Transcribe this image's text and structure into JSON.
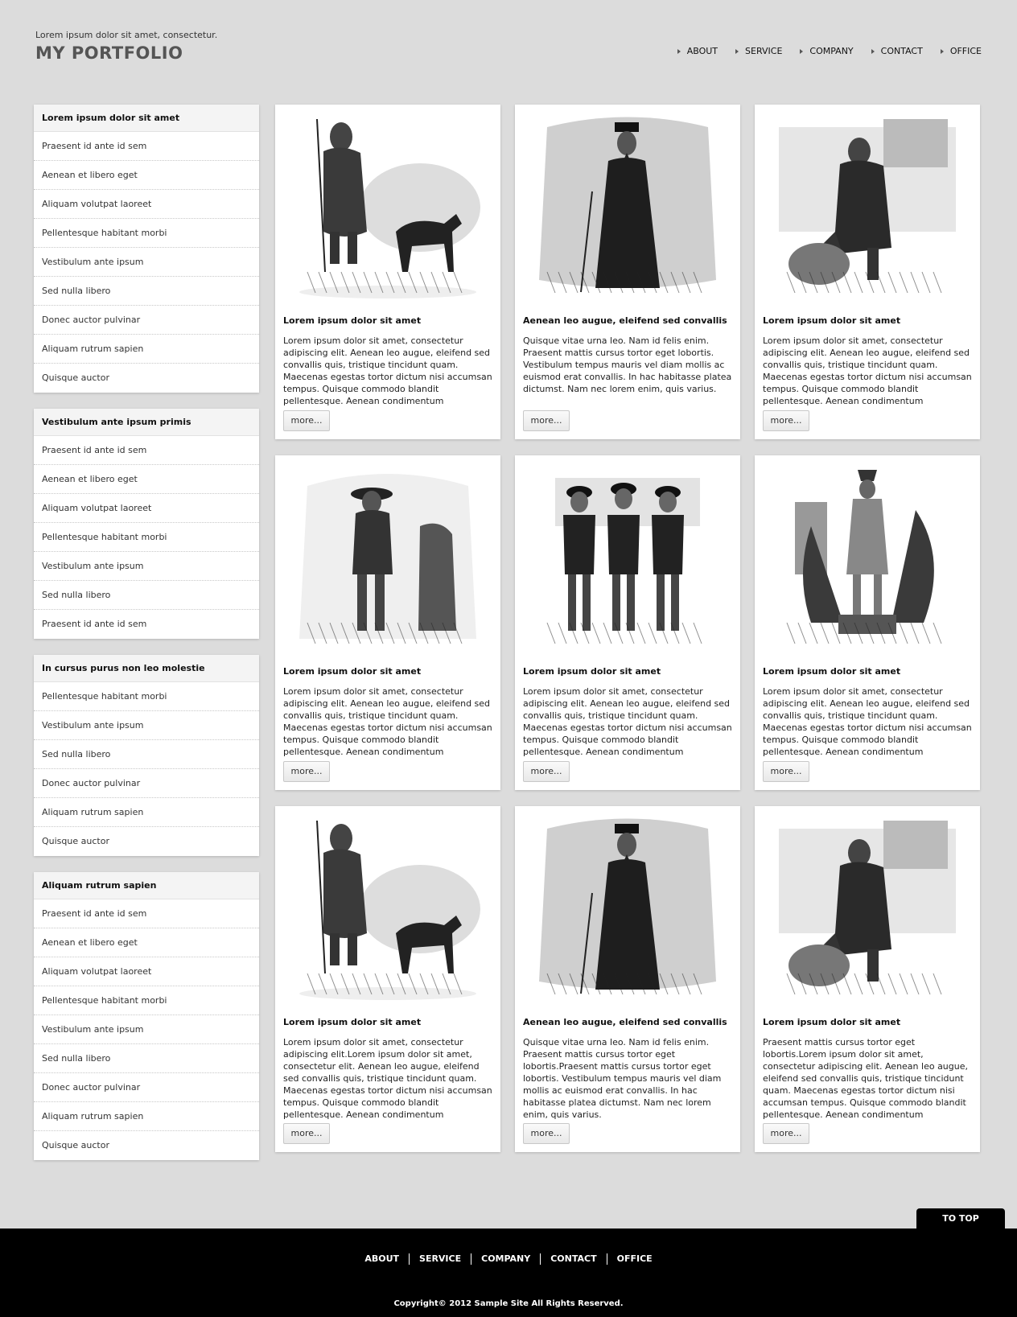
{
  "header": {
    "tagline": "Lorem ipsum dolor sit amet, consectetur.",
    "title": "MY PORTFOLIO",
    "nav": [
      "ABOUT",
      "SERVICE",
      "COMPANY",
      "CONTACT",
      "OFFICE"
    ]
  },
  "sidebar": [
    {
      "title": "Lorem ipsum dolor sit amet",
      "items": [
        "Praesent id ante id sem",
        "Aenean et libero eget",
        "Aliquam volutpat laoreet",
        "Pellentesque habitant morbi",
        "Vestibulum ante ipsum",
        "Sed nulla libero",
        "Donec auctor pulvinar",
        "Aliquam rutrum sapien",
        "Quisque auctor"
      ]
    },
    {
      "title": "Vestibulum ante ipsum primis",
      "items": [
        "Praesent id ante id sem",
        "Aenean et libero eget",
        "Aliquam volutpat laoreet",
        "Pellentesque habitant morbi",
        "Vestibulum ante ipsum",
        "Sed nulla libero",
        "Praesent id ante id sem"
      ]
    },
    {
      "title": "In cursus purus non leo molestie",
      "items": [
        "Pellentesque habitant morbi",
        "Vestibulum ante ipsum",
        "Sed nulla libero",
        "Donec auctor pulvinar",
        "Aliquam rutrum sapien",
        "Quisque auctor"
      ]
    },
    {
      "title": "Aliquam rutrum sapien",
      "items": [
        "Praesent id ante id sem",
        "Aenean et libero eget",
        "Aliquam volutpat laoreet",
        "Pellentesque habitant morbi",
        "Vestibulum ante ipsum",
        "Sed nulla libero",
        "Donec auctor pulvinar",
        "Aliquam rutrum sapien",
        "Quisque auctor"
      ]
    }
  ],
  "cards": [
    {
      "title": "Lorem ipsum dolor sit amet",
      "text": "Lorem ipsum dolor sit amet, consectetur adipiscing elit. Aenean leo augue, eleifend sed convallis quis, tristique tincidunt quam. Maecenas egestas tortor dictum nisi accumsan tempus. Quisque commodo blandit pellentesque. Aenean condimentum",
      "button": "more...",
      "image": "explorer-with-dog-engraving"
    },
    {
      "title": "Aenean leo augue, eleifend sed convallis",
      "text": "Quisque vitae urna leo. Nam id felis enim. Praesent mattis cursus tortor eget lobortis. Vestibulum tempus mauris vel diam mollis ac euismod erat convallis. In hac habitasse platea dictumst. Nam nec lorem enim, quis varius.",
      "button": "more...",
      "image": "robed-priest-engraving"
    },
    {
      "title": "Lorem ipsum dolor sit amet",
      "text": "Lorem ipsum dolor sit amet, consectetur adipiscing elit. Aenean leo augue, eleifend sed convallis quis, tristique tincidunt quam. Maecenas egestas tortor dictum nisi accumsan tempus. Quisque commodo blandit pellentesque. Aenean condimentum",
      "button": "more...",
      "image": "seated-man-engraving"
    },
    {
      "title": "Lorem ipsum dolor sit amet",
      "text": "Lorem ipsum dolor sit amet, consectetur adipiscing elit. Aenean leo augue, eleifend sed convallis quis, tristique tincidunt quam. Maecenas egestas tortor dictum nisi accumsan tempus. Quisque commodo blandit pellentesque. Aenean condimentum",
      "button": "more...",
      "image": "bandit-engraving"
    },
    {
      "title": "Lorem ipsum dolor sit amet",
      "text": "Lorem ipsum dolor sit amet, consectetur adipiscing elit. Aenean leo augue, eleifend sed convallis quis, tristique tincidunt quam. Maecenas egestas tortor dictum nisi accumsan tempus. Quisque commodo blandit pellentesque. Aenean condimentum",
      "button": "more...",
      "image": "three-matadors-engraving"
    },
    {
      "title": "Lorem ipsum dolor sit amet",
      "text": "Lorem ipsum dolor sit amet, consectetur adipiscing elit. Aenean leo augue, eleifend sed convallis quis, tristique tincidunt quam. Maecenas egestas tortor dictum nisi accumsan tempus. Quisque commodo blandit pellentesque. Aenean condimentum",
      "button": "more...",
      "image": "statue-engraving"
    },
    {
      "title": "Lorem ipsum dolor sit amet",
      "text": "Lorem ipsum dolor sit amet, consectetur adipiscing elit.Lorem ipsum dolor sit amet, consectetur elit. Aenean leo augue, eleifend sed convallis quis, tristique tincidunt quam. Maecenas egestas tortor dictum nisi accumsan tempus. Quisque commodo blandit pellentesque. Aenean condimentum",
      "button": "more...",
      "image": "explorer-with-dog-engraving"
    },
    {
      "title": "Aenean leo augue, eleifend sed convallis",
      "text": "Quisque vitae urna leo. Nam id felis enim. Praesent mattis cursus tortor eget lobortis.Praesent mattis cursus tortor eget lobortis. Vestibulum tempus mauris vel diam mollis ac euismod erat convallis. In hac habitasse platea dictumst. Nam nec lorem enim, quis varius.",
      "button": "more...",
      "image": "robed-priest-engraving"
    },
    {
      "title": "Lorem ipsum dolor sit amet",
      "text": "Praesent mattis cursus tortor eget lobortis.Lorem ipsum dolor sit amet, consectetur adipiscing elit. Aenean leo augue, eleifend sed convallis quis, tristique tincidunt quam. Maecenas egestas tortor dictum nisi accumsan tempus. Quisque commodo blandit pellentesque. Aenean condimentum",
      "button": "more...",
      "image": "seated-man-engraving"
    }
  ],
  "to_top": "TO TOP",
  "footer": {
    "nav": [
      "ABOUT",
      "SERVICE",
      "COMPANY",
      "CONTACT",
      "OFFICE"
    ],
    "copyright": "Copyright© 2012 Sample Site All Rights Reserved."
  }
}
